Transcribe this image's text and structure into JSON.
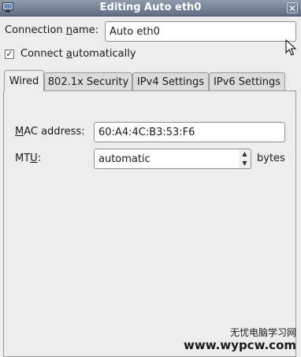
{
  "window": {
    "title": "Editing Auto eth0"
  },
  "connection": {
    "name_label_pre": "Connection ",
    "name_label_ul": "n",
    "name_label_post": "ame:",
    "name_value": "Auto eth0"
  },
  "autoconnect": {
    "checked_glyph": "✓",
    "label_pre": "Connect ",
    "label_ul": "a",
    "label_post": "utomatically"
  },
  "tabs": [
    {
      "label": "Wired"
    },
    {
      "label": "802.1x Security"
    },
    {
      "label": "IPv4 Settings"
    },
    {
      "label": "IPv6 Settings"
    }
  ],
  "wired": {
    "mac_label_ul": "M",
    "mac_label_post": "AC address:",
    "mac_value": "60:A4:4C:B3:53:F6",
    "mtu_label_pre": "MT",
    "mtu_label_ul": "U",
    "mtu_label_post": ":",
    "mtu_value": "automatic",
    "mtu_unit": "bytes"
  },
  "watermark": {
    "cn": "无忧电脑学习网",
    "url": "www.wypcw.com"
  },
  "icons": {
    "window": "network-window-icon",
    "close": "close-icon",
    "spin_up": "spin-up-icon",
    "spin_down": "spin-down-icon",
    "cursor": "mouse-cursor-icon"
  }
}
